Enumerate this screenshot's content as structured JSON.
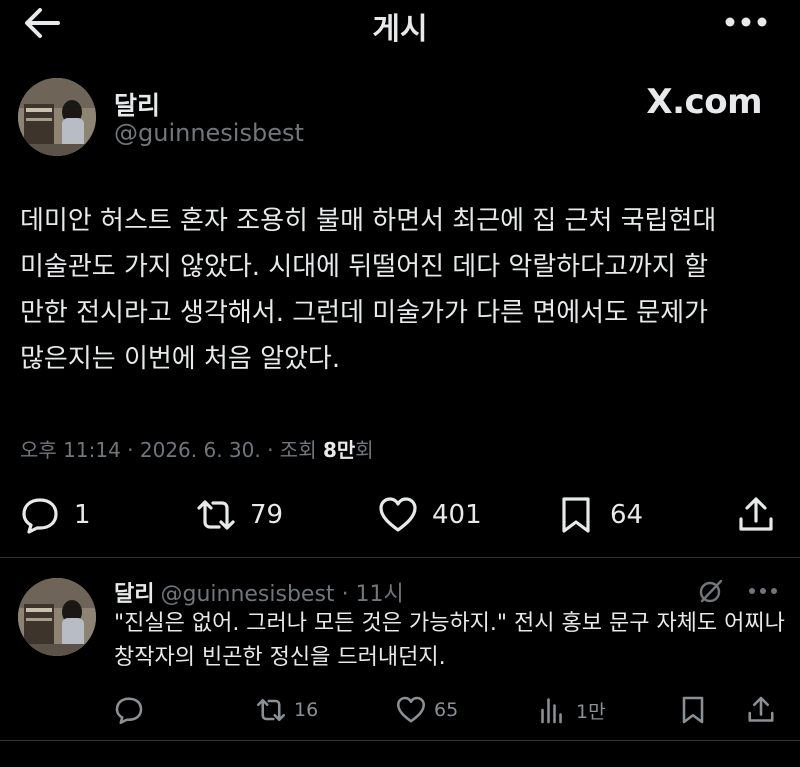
{
  "header": {
    "title": "게시"
  },
  "post": {
    "author_name": "달리",
    "author_handle": "@guinnesisbest",
    "watermark": "X.com",
    "text": "데미안 허스트 혼자 조용히 불매 하면서 최근에 집 근처 국립현대\n미술관도 가지 않았다. 시대에 뒤떨어진 데다 악랄하다고까지 할\n만한 전시라고 생각해서. 그런데 미술가가 다른 면에서도 문제가\n많은지는 이번에 처음 알았다.",
    "time": "오후 11:14 · 2026. 6. 30. · 조회 ",
    "views_count": "8만",
    "views_suffix": "회",
    "replies": "1",
    "reposts": "79",
    "likes": "401",
    "bookmarks": "64"
  },
  "reply": {
    "author_name": "달리",
    "author_handle": "@guinnesisbest",
    "time": "· 11시",
    "text": "\"진실은 없어. 그러나 모든 것은 가능하지.\" 전시 홍보 문구 자체도 어찌나 창작자의 빈곤한 정신을 드러내던지.",
    "replies": "",
    "reposts": "16",
    "likes": "65",
    "views": "1만"
  },
  "icons": {
    "back": "arrow-left-icon",
    "more": "ellipsis-icon",
    "reply": "speech-bubble-icon",
    "repost": "repost-arrows-icon",
    "like": "heart-icon",
    "bookmark": "bookmark-icon",
    "share": "share-upload-icon",
    "views": "bar-chart-icon",
    "grok": "grok-slash-icon"
  },
  "colors": {
    "background": "#000000",
    "text_primary": "#e7e9ea",
    "text_secondary": "#71767b",
    "divider": "#2f3336"
  }
}
